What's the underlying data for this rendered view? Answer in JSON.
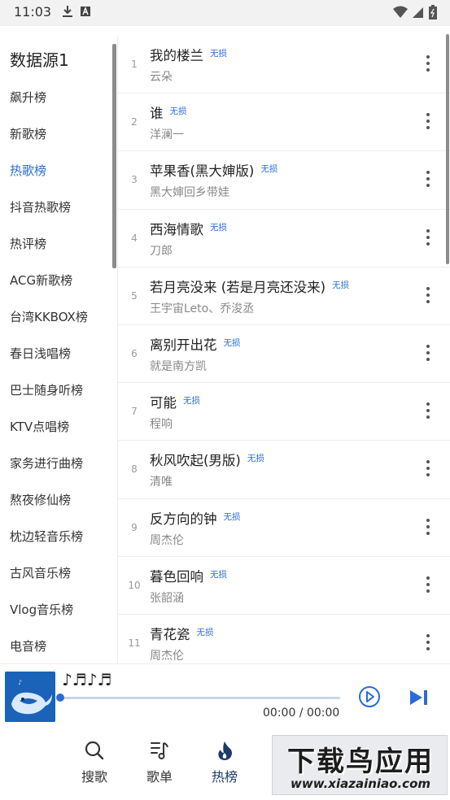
{
  "status_bar": {
    "time": "11:03",
    "left_icons": [
      "download-icon",
      "a-badge-icon"
    ],
    "right_icons": [
      "wifi-icon",
      "signal-icon",
      "battery-icon"
    ]
  },
  "sidebar": {
    "title": "数据源1",
    "active_index": 2,
    "items": [
      {
        "label": "飙升榜"
      },
      {
        "label": "新歌榜"
      },
      {
        "label": "热歌榜"
      },
      {
        "label": "抖音热歌榜"
      },
      {
        "label": "热评榜"
      },
      {
        "label": "ACG新歌榜"
      },
      {
        "label": "台湾KKBOX榜"
      },
      {
        "label": "春日浅唱榜"
      },
      {
        "label": "巴士随身听榜"
      },
      {
        "label": "KTV点唱榜"
      },
      {
        "label": "家务进行曲榜"
      },
      {
        "label": "熬夜修仙榜"
      },
      {
        "label": "枕边轻音乐榜"
      },
      {
        "label": "古风音乐榜"
      },
      {
        "label": "Vlog音乐榜"
      },
      {
        "label": "电音榜"
      }
    ]
  },
  "songs": [
    {
      "num": "1",
      "title": "我的楼兰",
      "badge": "无损",
      "artist": "云朵"
    },
    {
      "num": "2",
      "title": "谁",
      "badge": "无损",
      "artist": "洋澜一"
    },
    {
      "num": "3",
      "title": "苹果香(黑大婶版)",
      "badge": "无损",
      "artist": "黑大婶回乡带娃"
    },
    {
      "num": "4",
      "title": "西海情歌",
      "badge": "无损",
      "artist": "刀郎"
    },
    {
      "num": "5",
      "title": "若月亮没来 (若是月亮还没来)",
      "badge": "无损",
      "artist": "王宇宙Leto、乔浚丞"
    },
    {
      "num": "6",
      "title": "离别开出花",
      "badge": "无损",
      "artist": "就是南方凯"
    },
    {
      "num": "7",
      "title": "可能",
      "badge": "无损",
      "artist": "程响"
    },
    {
      "num": "8",
      "title": "秋风吹起(男版)",
      "badge": "无损",
      "artist": "清唯"
    },
    {
      "num": "9",
      "title": "反方向的钟",
      "badge": "无损",
      "artist": "周杰伦"
    },
    {
      "num": "10",
      "title": "暮色回响",
      "badge": "无损",
      "artist": "张韶涵"
    },
    {
      "num": "11",
      "title": "青花瓷",
      "badge": "无损",
      "artist": "周杰伦"
    }
  ],
  "player": {
    "title": "♪♬♪♬",
    "progress": 0,
    "time": "00:00 / 00:00",
    "cover_icon": "whale-cover-icon"
  },
  "bottom_nav": {
    "active_index": 2,
    "items": [
      {
        "label": "搜歌",
        "icon": "search-icon"
      },
      {
        "label": "歌单",
        "icon": "playlist-icon"
      },
      {
        "label": "热榜",
        "icon": "flame-icon"
      }
    ]
  },
  "watermark": {
    "title": "下载鸟应用",
    "url": "www.xiazainiao.com"
  },
  "colors": {
    "accent": "#2a6cd6",
    "text": "#222222",
    "muted": "#888888"
  }
}
